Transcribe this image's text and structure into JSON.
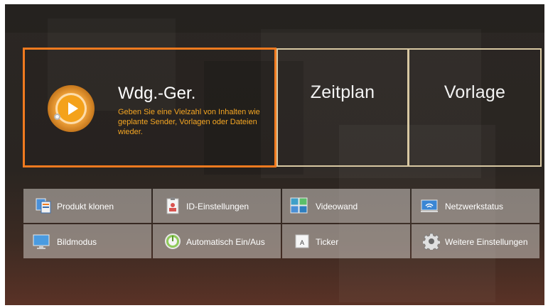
{
  "main_tile": {
    "title": "Wdg.-Ger.",
    "description": "Geben Sie eine Vielzahl von Inhalten wie geplante Sender, Vorlagen oder Dateien wieder.",
    "icon": "play-icon"
  },
  "tiles": [
    {
      "label": "Zeitplan"
    },
    {
      "label": "Vorlage"
    }
  ],
  "menu": [
    {
      "label": "Produkt klonen",
      "icon": "clone-icon"
    },
    {
      "label": "ID-Einstellungen",
      "icon": "id-card-icon"
    },
    {
      "label": "Videowand",
      "icon": "videowall-icon"
    },
    {
      "label": "Netzwerkstatus",
      "icon": "network-icon"
    },
    {
      "label": "Bildmodus",
      "icon": "monitor-icon"
    },
    {
      "label": "Automatisch Ein/Aus",
      "icon": "power-icon"
    },
    {
      "label": "Ticker",
      "icon": "ticker-icon"
    },
    {
      "label": "Weitere Einstellungen",
      "icon": "gear-icon"
    }
  ],
  "colors": {
    "focus_border": "#f07a1f",
    "tile_border": "#d8c8a2",
    "description_text": "#f5a623"
  }
}
